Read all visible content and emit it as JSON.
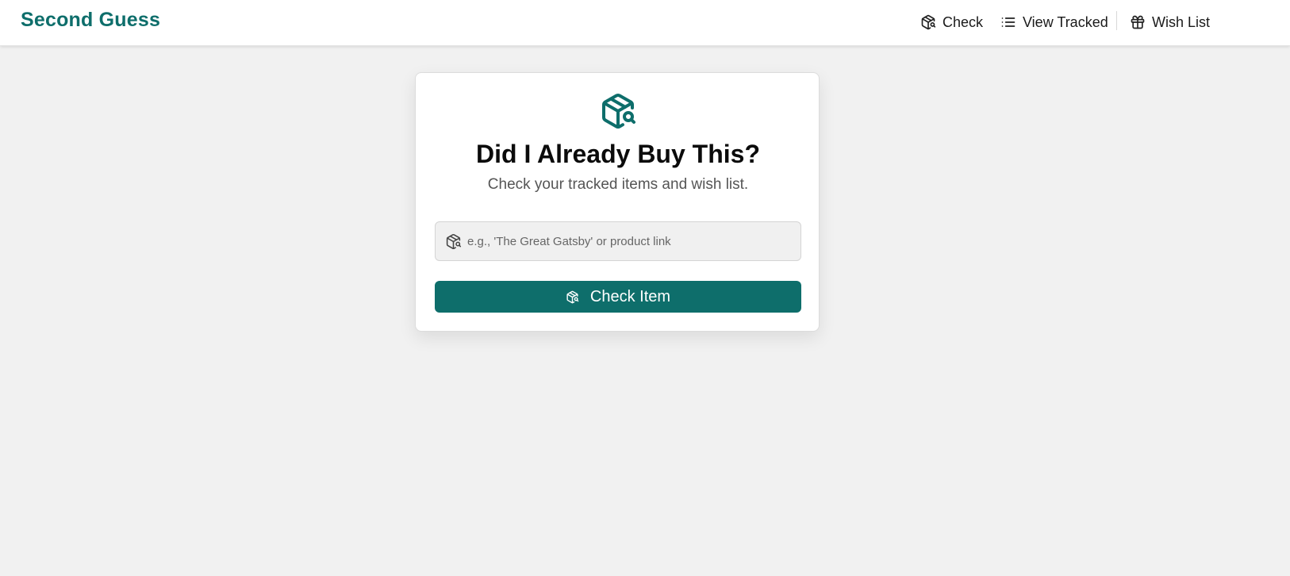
{
  "header": {
    "brand": "Second Guess",
    "nav": [
      {
        "label": "Check",
        "icon": "package-search-icon"
      },
      {
        "label": "View Tracked",
        "icon": "list-icon"
      },
      {
        "label": "Wish List",
        "icon": "gift-icon"
      }
    ]
  },
  "card": {
    "icon": "package-search-icon",
    "title": "Did I Already Buy This?",
    "subtitle": "Check your tracked items and wish list.",
    "search": {
      "placeholder": "e.g., 'The Great Gatsby' or product link",
      "value": ""
    },
    "button_label": "Check Item"
  },
  "colors": {
    "accent": "#0e6e6b",
    "background": "#f1f1f1",
    "card": "#ffffff"
  }
}
